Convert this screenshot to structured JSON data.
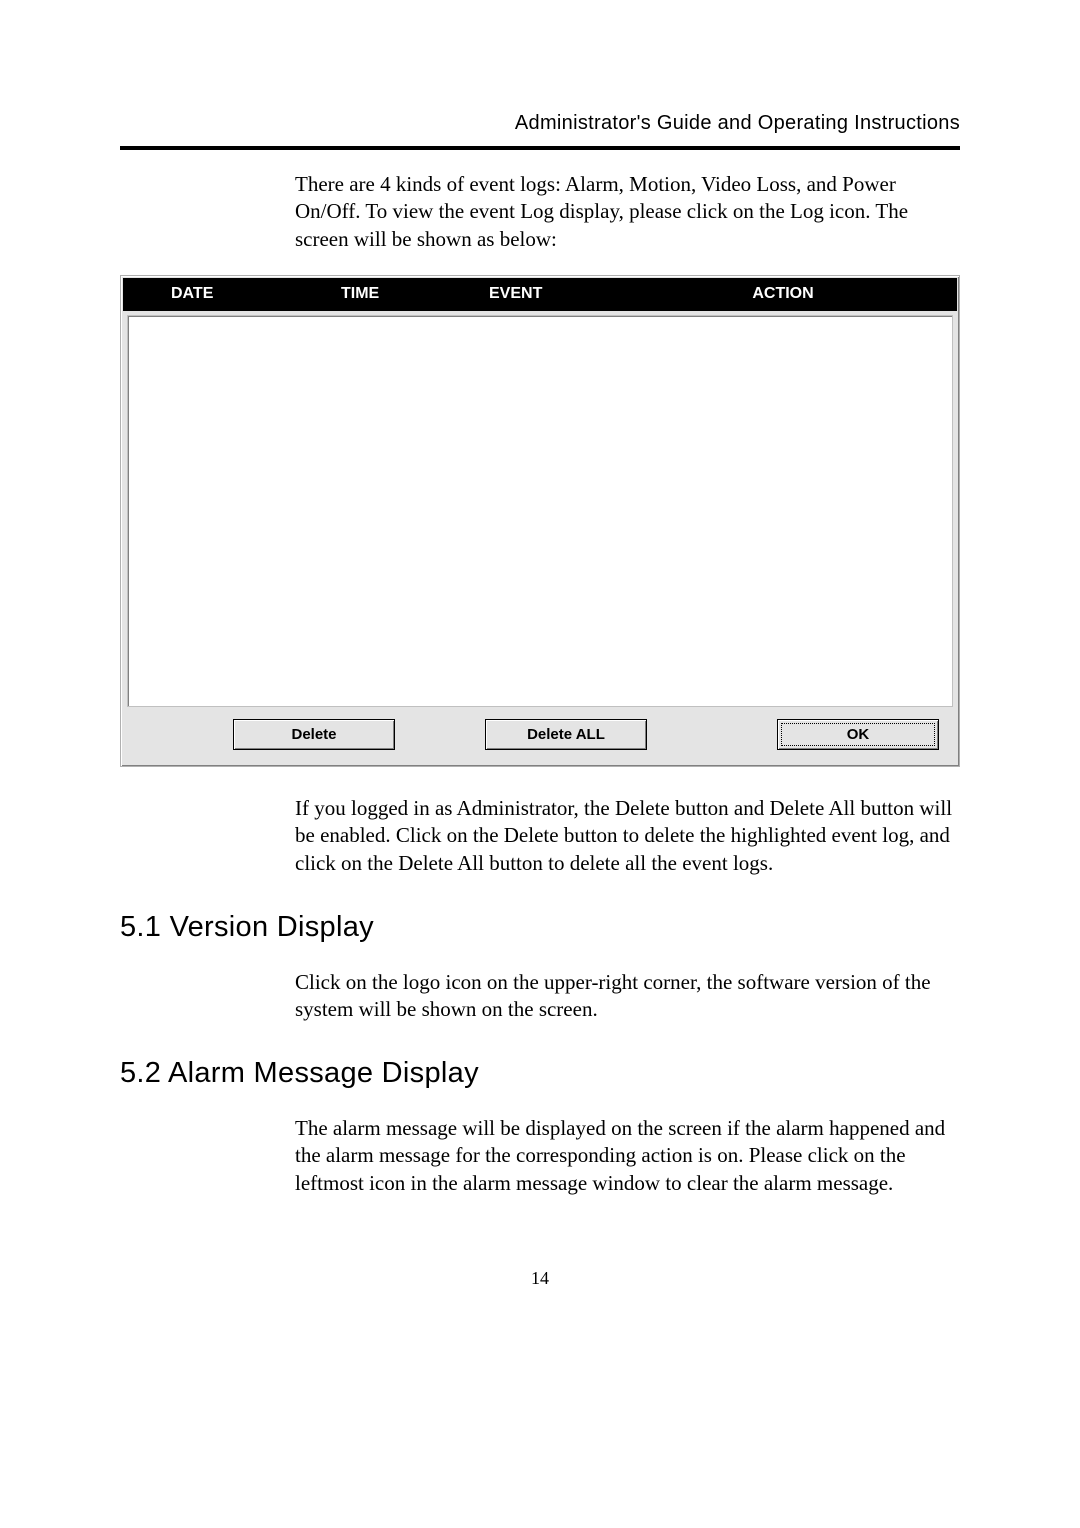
{
  "running_header": "Administrator's Guide and Operating Instructions",
  "para1": "There are 4 kinds of event logs: Alarm, Motion, Video Loss, and Power On/Off.   To view the event Log display, please click on the Log icon.   The screen will be shown as below:",
  "fig": {
    "headers": {
      "date": "DATE",
      "time": "TIME",
      "event": "EVENT",
      "action": "ACTION"
    },
    "buttons": {
      "delete": "Delete",
      "delete_all": "Delete ALL",
      "ok": "OK"
    }
  },
  "para2": "If you logged in as Administrator, the Delete button and Delete All button will be enabled.   Click on the Delete button to delete the highlighted event log, and click on the Delete All button to delete all the event logs.",
  "section51": {
    "heading": "5.1 Version Display",
    "body": "Click on the logo icon on the upper-right corner, the software version of the system will be shown on the screen."
  },
  "section52": {
    "heading": "5.2 Alarm Message Display",
    "body": "The alarm message will be displayed on the screen if the alarm happened and the alarm message for the corresponding action is on. Please click on the leftmost icon in the alarm message window to clear the alarm message."
  },
  "page_number": "14"
}
